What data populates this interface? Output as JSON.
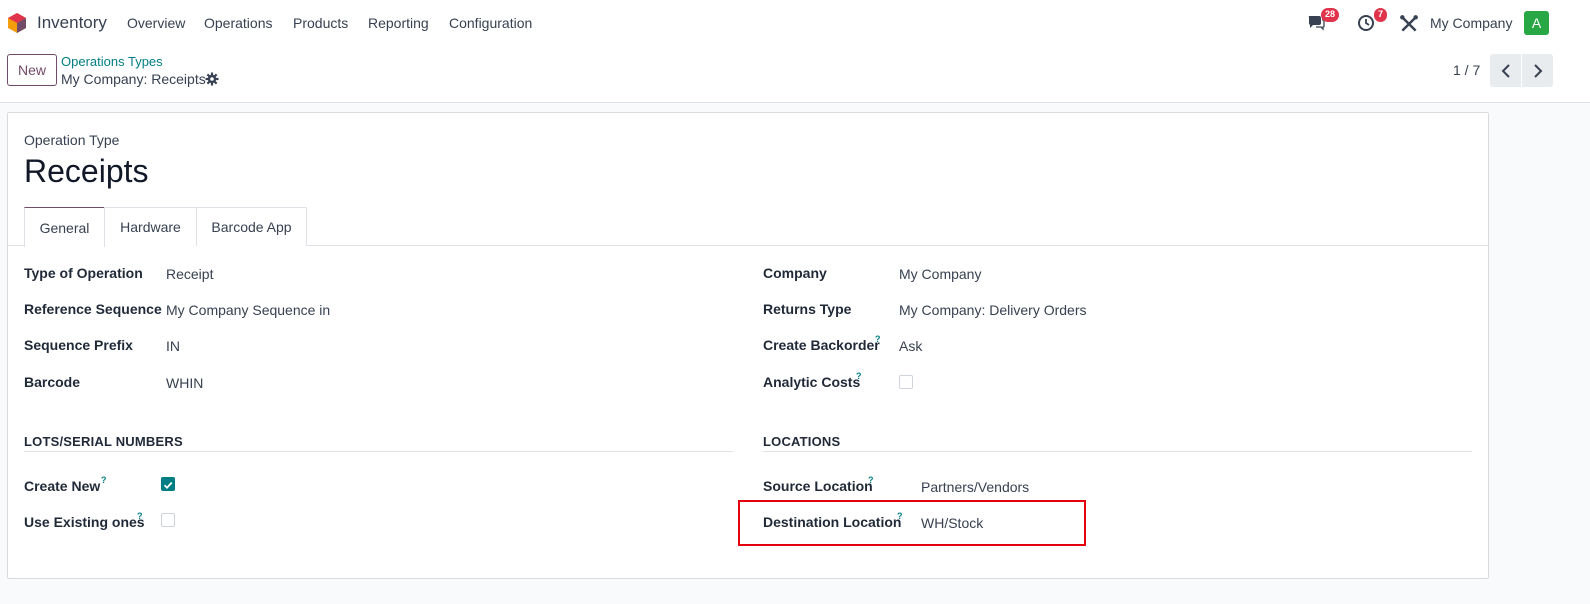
{
  "navbar": {
    "app_name": "Inventory",
    "menus": [
      "Overview",
      "Operations",
      "Products",
      "Reporting",
      "Configuration"
    ],
    "messages_count": "28",
    "activities_count": "7",
    "company": "My Company",
    "avatar_letter": "A"
  },
  "control_panel": {
    "new_label": "New",
    "breadcrumb_parent": "Operations Types",
    "record_name": "My Company: Receipts",
    "pager": "1 / 7"
  },
  "form": {
    "type_label": "Operation Type",
    "title": "Receipts",
    "tabs": [
      "General",
      "Hardware",
      "Barcode App"
    ],
    "left_fields": [
      {
        "label": "Type of Operation",
        "value": "Receipt"
      },
      {
        "label": "Reference Sequence",
        "value": "My Company Sequence in"
      },
      {
        "label": "Sequence Prefix",
        "value": "IN"
      },
      {
        "label": "Barcode",
        "value": "WHIN"
      }
    ],
    "right_fields": [
      {
        "label": "Company",
        "value": "My Company"
      },
      {
        "label": "Returns Type",
        "value": "My Company: Delivery Orders"
      },
      {
        "label": "Create Backorder",
        "value": "Ask"
      },
      {
        "label": "Analytic Costs",
        "value": ""
      }
    ],
    "lots_section": {
      "title": "LOTS/SERIAL NUMBERS",
      "create_new_label": "Create New",
      "create_new_checked": true,
      "use_existing_label": "Use Existing ones",
      "use_existing_checked": false
    },
    "locations_section": {
      "title": "LOCATIONS",
      "source_label": "Source Location",
      "source_value": "Partners/Vendors",
      "destination_label": "Destination Location",
      "destination_value": "WH/Stock"
    },
    "help_mark": "?"
  },
  "colors": {
    "brand": "#714b67",
    "link": "#017e84",
    "highlight": "#e3000f",
    "badge": "#e0334c",
    "avatar": "#28a745"
  }
}
